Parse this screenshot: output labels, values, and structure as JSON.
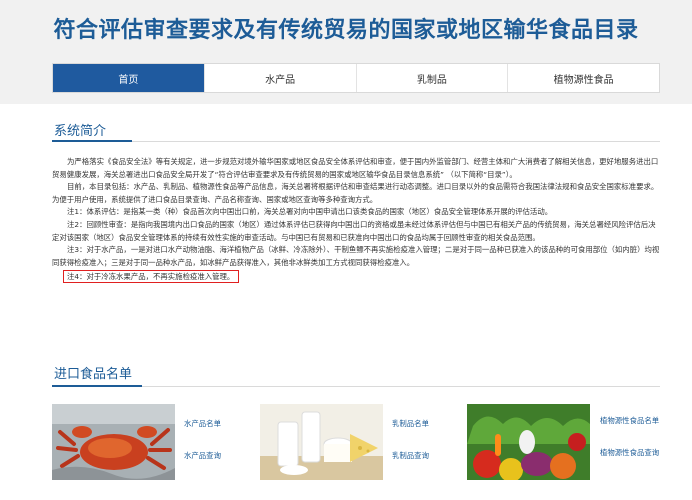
{
  "header": {
    "title": "符合评估审查要求及有传统贸易的国家或地区输华食品目录"
  },
  "nav": {
    "items": [
      {
        "label": "首页",
        "active": true
      },
      {
        "label": "水产品",
        "active": false
      },
      {
        "label": "乳制品",
        "active": false
      },
      {
        "label": "植物源性食品",
        "active": false
      }
    ]
  },
  "intro": {
    "heading": "系统简介",
    "paragraphs": [
      "为严格落实《食品安全法》等有关规定，进一步规范对境外输华国家或地区食品安全体系评估和审查，便于国内外监管部门、经营主体和广大消费者了解相关信息，更好地服务进出口贸易健康发展，海关总署进出口食品安全局开发了“符合评估审查要求及有传统贸易的国家或地区输华食品目录信息系统” （以下简称“目录”）。",
      "目前，本目录包括：水产品、乳制品、植物源性食品等产品信息，海关总署将根据评估和审查结果进行动态调整。进口目录以外的食品需符合我国法律法规和食品安全国家标准要求。为便于用户使用，系统提供了进口食品目录查询、产品名称查询、国家或地区查询等多种查询方式。",
      "注1：体系评估：是指某一类（种）食品首次向中国出口前，海关总署对向中国申请出口该类食品的国家（地区）食品安全管理体系开展的评估活动。",
      "注2：回顾性审查：是指向我国境内出口食品的国家（地区）通过体系评估已获得向中国出口的资格或虽未经过体系评估但与中国已有相关产品的传统贸易，海关总署经风险评估后决定对该国家（地区）食品安全管理体系的持续有效性实施的审查活动。与中国已有贸易和已获准向中国出口的食品均属于回顾性审查的相关食品范围。",
      "注3：对于水产品，一是对进口水产动物油脂、海洋植物产品（冰鲜、冷冻除外）、干制鱼鳔不再实施检疫准入管理；二是对于同一品种已获准入的该品种的可食用部位（如内脏）均视同获得检疫准入；三是对于同一品种水产品，如冰鲜产品获得准入，其他非冰鲜类加工方式视同获得检疫准入。"
    ],
    "note4": "注4：对于冷冻水果产品，不再实施检疫准入管理。"
  },
  "catalog": {
    "heading": "进口食品名单",
    "categories": [
      {
        "icon": "seafood-image",
        "list_label": "水产品名单",
        "query_label": "水产品查询"
      },
      {
        "icon": "dairy-image",
        "list_label": "乳制品名单",
        "query_label": "乳制品查询"
      },
      {
        "icon": "produce-image",
        "list_label": "植物源性食品名单",
        "query_label": "植物源性食品查询"
      }
    ]
  },
  "colors": {
    "brand_blue": "#1d5c97",
    "nav_active": "#1f5a9f",
    "highlight_border": "#e02020"
  }
}
